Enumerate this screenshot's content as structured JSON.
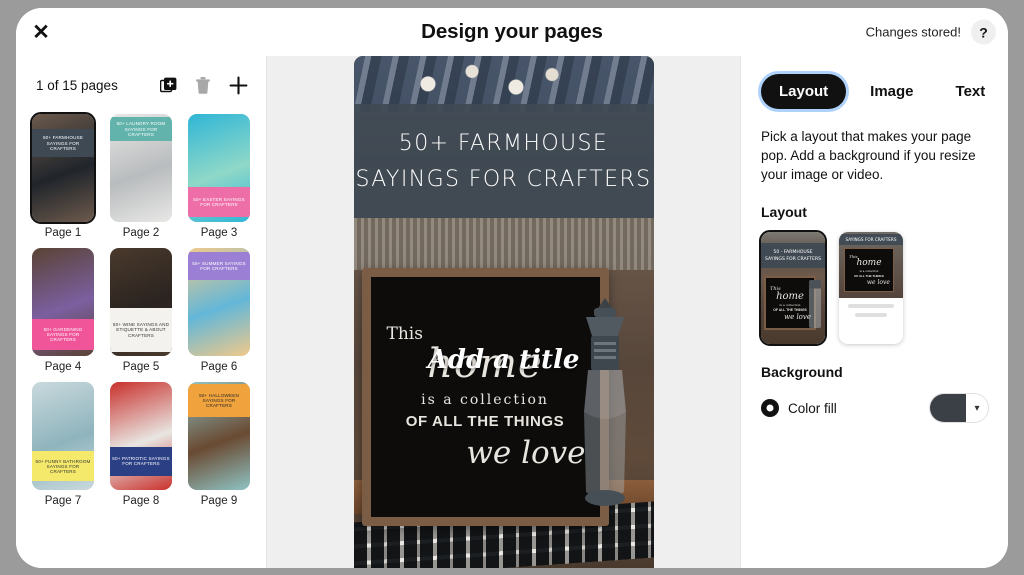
{
  "header": {
    "close_icon": "close-icon",
    "title": "Design your pages",
    "status": "Changes stored!",
    "help_label": "?"
  },
  "sidebar": {
    "page_count": "1 of 15 pages",
    "actions": [
      {
        "name": "duplicate-page-button",
        "icon": "duplicate-icon"
      },
      {
        "name": "delete-page-button",
        "icon": "trash-icon"
      },
      {
        "name": "add-page-button",
        "icon": "plus-icon"
      }
    ],
    "pages": [
      {
        "label": "Page 1",
        "selected": true,
        "title": "50+ FARMHOUSE SAYINGS FOR CRAFTERS",
        "band_bg": "#3e4954",
        "band_fg": "#ffffff",
        "band_top": "14%",
        "band_height": "26%",
        "art_a": "#6d5a4c",
        "art_b": "#20252b"
      },
      {
        "label": "Page 2",
        "selected": false,
        "title": "50+ LAUNDRY ROOM SAYINGS FOR CRAFTERS",
        "band_bg": "#63b3ad",
        "band_fg": "#ffffff",
        "band_top": "3%",
        "band_height": "22%",
        "art_a": "#e8e8e6",
        "art_b": "#b9bcbe"
      },
      {
        "label": "Page 3",
        "selected": false,
        "title": "50+ EASTER SAYINGS FOR CRAFTERS",
        "band_bg": "#ee6fa8",
        "band_fg": "#ffffff",
        "band_top": "68%",
        "band_height": "27%",
        "art_a": "#2fb6d6",
        "art_b": "#8fd8c8"
      },
      {
        "label": "Page 4",
        "selected": false,
        "title": "50+ GARDENING SAYINGS FOR CRAFTERS",
        "band_bg": "#f0559a",
        "band_fg": "#ffffff",
        "band_top": "66%",
        "band_height": "28%",
        "art_a": "#5a4334",
        "art_b": "#7b5fa0"
      },
      {
        "label": "Page 5",
        "selected": false,
        "title": "50+ WINE SAYINGS AND ETIQUETTE & ABOUT CRAFTERS",
        "band_bg": "#f4f2ee",
        "band_fg": "#333333",
        "band_top": "56%",
        "band_height": "40%",
        "art_a": "#4a3a2c",
        "art_b": "#2a2320"
      },
      {
        "label": "Page 6",
        "selected": false,
        "title": "50+ SUMMER SAYINGS FOR CRAFTERS",
        "band_bg": "#9b7fd4",
        "band_fg": "#ffffff",
        "band_top": "4%",
        "band_height": "26%",
        "art_a": "#f0c98a",
        "art_b": "#63b7d8"
      },
      {
        "label": "Page 7",
        "selected": false,
        "title": "50+ FUNNY BATHROOM SAYINGS FOR CRAFTERS",
        "band_bg": "#f5e96b",
        "band_fg": "#333333",
        "band_top": "64%",
        "band_height": "28%",
        "art_a": "#c9d9dd",
        "art_b": "#8fb4bd"
      },
      {
        "label": "Page 8",
        "selected": false,
        "title": "50+ PATRIOTIC SAYINGS FOR CRAFTERS",
        "band_bg": "#2b3f84",
        "band_fg": "#ffffff",
        "band_top": "60%",
        "band_height": "27%",
        "art_a": "#c9302c",
        "art_b": "#e8e6e2"
      },
      {
        "label": "Page 9",
        "selected": false,
        "title": "50+ HALLOWEEN SAYINGS FOR CRAFTERS",
        "band_bg": "#f0a23c",
        "band_fg": "#2a2a2a",
        "band_top": "2%",
        "band_height": "30%",
        "art_a": "#8fc4c4",
        "art_b": "#6a4a32"
      }
    ]
  },
  "preview": {
    "title_line1": "50+ FARMHOUSE",
    "title_line2": "SAYINGS FOR CRAFTERS",
    "overlay_title": "Add a title",
    "sign": {
      "line1": "This",
      "line2": "home",
      "line3": "is a collection",
      "line4": "OF ALL THE THINGS",
      "line5": "we love"
    }
  },
  "right_panel": {
    "tabs": [
      {
        "label": "Layout",
        "active": true
      },
      {
        "label": "Image",
        "active": false
      },
      {
        "label": "Text",
        "active": false
      }
    ],
    "description": "Pick a layout that makes your page pop. Add a background if you resize your image or video.",
    "layout_section_title": "Layout",
    "layout_options": [
      {
        "name": "layout-option-full-bleed",
        "selected": true
      },
      {
        "name": "layout-option-split",
        "selected": false
      }
    ],
    "layout_thumb_title": "SAYINGS FOR CRAFTERS",
    "background_section_title": "Background",
    "color_fill_label": "Color fill",
    "color_fill_value": "#3b4047",
    "caret_icon": "chevron-down-icon"
  }
}
